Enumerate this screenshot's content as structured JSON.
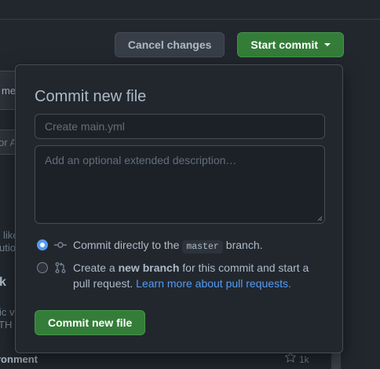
{
  "header": {
    "cancel_label": "Cancel changes",
    "start_commit_label": "Start commit"
  },
  "background": {
    "frag_me": "me",
    "frag_or": "or A",
    "frag_like": "like",
    "frag_utio": "utio",
    "frag_k": "k",
    "frag_ic": "ic v",
    "frag_th": "TH",
    "frag_env": "ronment",
    "star_count": "1k"
  },
  "popover": {
    "title": "Commit new file",
    "summary_placeholder": "Create main.yml",
    "description_placeholder": "Add an optional extended description…",
    "option_direct": {
      "prefix": "Commit directly to the",
      "branch": "master",
      "suffix": "branch.",
      "checked": true
    },
    "option_new_branch": {
      "prefix": "Create a",
      "bold": "new branch",
      "middle": "for this commit and start a pull request.",
      "link": "Learn more about pull requests.",
      "checked": false
    },
    "submit_label": "Commit new file"
  },
  "colors": {
    "accent_blue": "#539bf5",
    "primary_green": "#347d39",
    "background": "#22272e"
  },
  "icons": [
    "git-commit-icon",
    "git-pull-request-icon",
    "chevron-down-icon",
    "star-icon"
  ]
}
